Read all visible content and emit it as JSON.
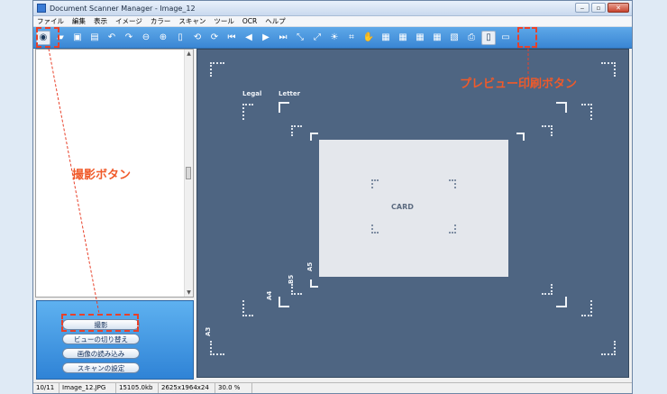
{
  "window": {
    "title": "Document Scanner Manager - Image_12"
  },
  "menu": [
    "ファイル",
    "編集",
    "表示",
    "イメージ",
    "カラー",
    "スキャン",
    "ツール",
    "OCR",
    "ヘルプ"
  ],
  "toolbar_icons": [
    "camera-icon",
    "open-folder-icon",
    "save-icon",
    "save-as-icon",
    "undo-icon",
    "redo-icon",
    "zoom-out-icon",
    "zoom-in-icon",
    "page-icon",
    "rotate-left-icon",
    "rotate-right-icon",
    "first-page-icon",
    "prev-page-icon",
    "next-page-icon",
    "last-page-icon",
    "deskew-icon",
    "rotate-free-icon",
    "brightness-icon",
    "crop-icon",
    "hand-icon",
    "scan-tool-1-icon",
    "scan-tool-2-icon",
    "scan-tool-3-icon",
    "scan-tool-4-icon",
    "ocr-icon",
    "print-icon",
    "print-preview-icon",
    "fullscreen-icon"
  ],
  "panel_buttons": [
    "撮影",
    "ビューの切り替え",
    "画像の読み込み",
    "スキャンの設定"
  ],
  "preview": {
    "card_label": "CARD",
    "size_labels": {
      "legal": "Legal",
      "letter": "Letter",
      "a3": "A3",
      "a4": "A4",
      "a5": "A5",
      "b5": "B5"
    }
  },
  "status": {
    "page": "10/11",
    "filename": "Image_12.JPG",
    "filesize": "15105.0kb",
    "dimensions": "2625x1964x24",
    "zoom": "30.0 %"
  },
  "annotations": {
    "shoot_button": "撮影ボタン",
    "print_preview_button": "プレビュー印刷ボタン"
  },
  "colors": {
    "accent": "#f05a2a",
    "toolbar": "#4a96de",
    "preview_bg": "#4e6582"
  }
}
